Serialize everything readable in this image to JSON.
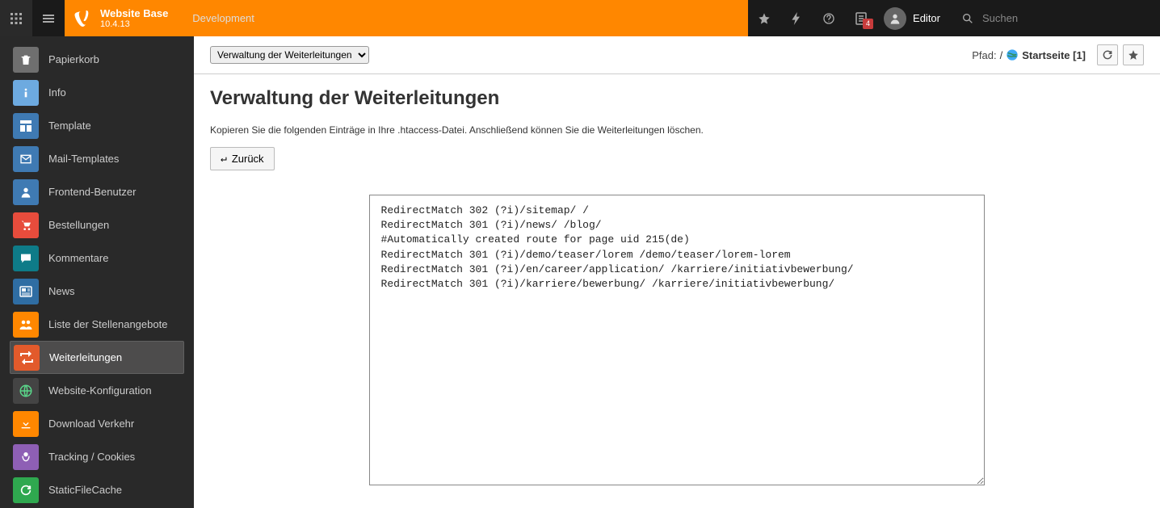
{
  "topbar": {
    "site_name": "Website Base",
    "version": "10.4.13",
    "environment": "Development",
    "user_name": "Editor",
    "search_placeholder": "Suchen",
    "notification_count": "4"
  },
  "sidebar": {
    "items": [
      {
        "label": "Papierkorb"
      },
      {
        "label": "Info"
      },
      {
        "label": "Template"
      },
      {
        "label": "Mail-Templates"
      },
      {
        "label": "Frontend-Benutzer"
      },
      {
        "label": "Bestellungen"
      },
      {
        "label": "Kommentare"
      },
      {
        "label": "News"
      },
      {
        "label": "Liste der Stellenangebote"
      },
      {
        "label": "Weiterleitungen"
      },
      {
        "label": "Website-Konfiguration"
      },
      {
        "label": "Download Verkehr"
      },
      {
        "label": "Tracking / Cookies"
      },
      {
        "label": "StaticFileCache"
      }
    ]
  },
  "content": {
    "module_select_value": "Verwaltung der Weiterleitungen",
    "path_label": "Pfad:",
    "path_sep": "/",
    "path_target": "Startseite [1]",
    "title": "Verwaltung der Weiterleitungen",
    "description": "Kopieren Sie die folgenden Einträge in Ihre .htaccess-Datei. Anschließend können Sie die Weiterleitungen löschen.",
    "back_label": "Zurück",
    "redirect_text": "RedirectMatch 302 (?i)/sitemap/ /\nRedirectMatch 301 (?i)/news/ /blog/\n#Automatically created route for page uid 215(de)\nRedirectMatch 301 (?i)/demo/teaser/lorem /demo/teaser/lorem-lorem\nRedirectMatch 301 (?i)/en/career/application/ /karriere/initiativbewerbung/\nRedirectMatch 301 (?i)/karriere/bewerbung/ /karriere/initiativbewerbung/"
  },
  "colors": {
    "brand_orange": "#ff8700",
    "dark": "#1a1a1a",
    "sidebar": "#292929"
  }
}
